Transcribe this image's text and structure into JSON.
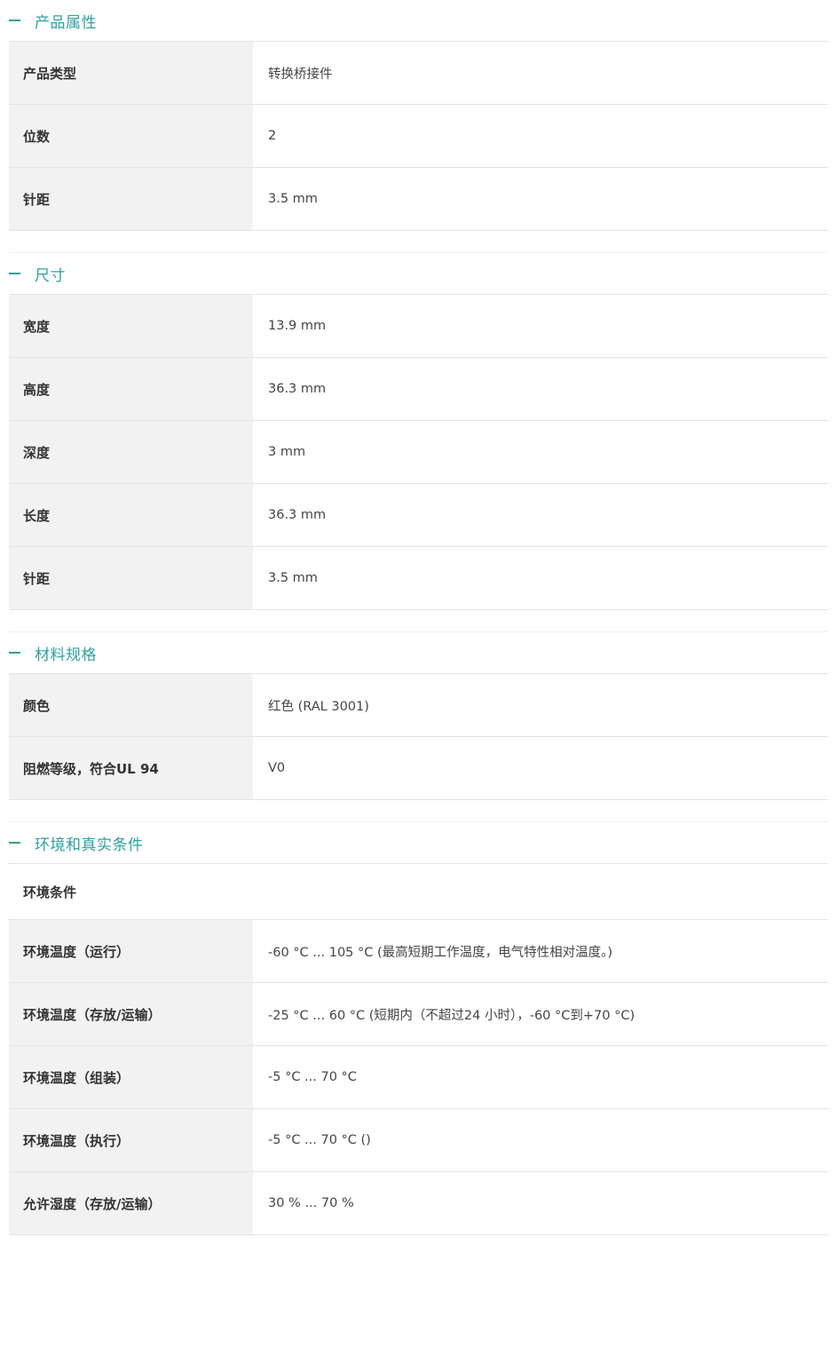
{
  "sections": [
    {
      "title": "产品属性",
      "rows": [
        {
          "label": "产品类型",
          "value": "转换桥接件"
        },
        {
          "label": "位数",
          "value": "2"
        },
        {
          "label": "针距",
          "value": "3.5 mm"
        }
      ]
    },
    {
      "title": "尺寸",
      "rows": [
        {
          "label": "宽度",
          "value": "13.9 mm"
        },
        {
          "label": "高度",
          "value": "36.3 mm"
        },
        {
          "label": "深度",
          "value": "3 mm"
        },
        {
          "label": "长度",
          "value": "36.3 mm"
        },
        {
          "label": "针距",
          "value": "3.5 mm"
        }
      ]
    },
    {
      "title": "材料规格",
      "rows": [
        {
          "label": "颜色",
          "value": "红色 (RAL 3001)"
        },
        {
          "label": "阻燃等级，符合UL 94",
          "value": "V0"
        }
      ]
    },
    {
      "title": "环境和真实条件",
      "subheader": "环境条件",
      "rows": [
        {
          "label": "环境温度（运行）",
          "value": "-60 °C ... 105 °C (最高短期工作温度，电气特性相对温度。)"
        },
        {
          "label": "环境温度（存放/运输）",
          "value": "-25 °C ... 60 °C (短期内（不超过24  小时），-60 °C到+70 °C)"
        },
        {
          "label": "环境温度（组装）",
          "value": "-5 °C ... 70 °C"
        },
        {
          "label": "环境温度（执行）",
          "value": "-5 °C ... 70 °C ()"
        },
        {
          "label": "允许湿度（存放/运输）",
          "value": "30 % ... 70 %"
        }
      ]
    }
  ]
}
